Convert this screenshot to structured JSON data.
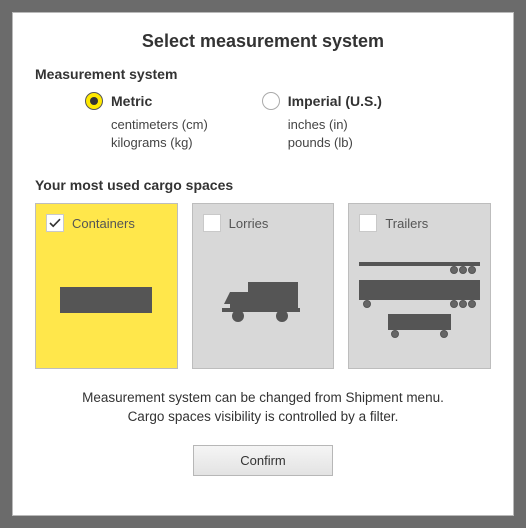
{
  "title": "Select measurement system",
  "measurement": {
    "section_label": "Measurement system",
    "metric": {
      "label": "Metric",
      "sub1": "centimeters (cm)",
      "sub2": "kilograms (kg)",
      "selected": true
    },
    "imperial": {
      "label": "Imperial (U.S.)",
      "sub1": "inches (in)",
      "sub2": "pounds (lb)",
      "selected": false
    }
  },
  "cargo": {
    "section_label": "Your most used cargo spaces",
    "cards": [
      {
        "label": "Containers",
        "selected": true
      },
      {
        "label": "Lorries",
        "selected": false
      },
      {
        "label": "Trailers",
        "selected": false
      }
    ]
  },
  "hint_line1": "Measurement system can be changed from Shipment menu.",
  "hint_line2": "Cargo spaces visibility is controlled by a filter.",
  "confirm_label": "Confirm"
}
